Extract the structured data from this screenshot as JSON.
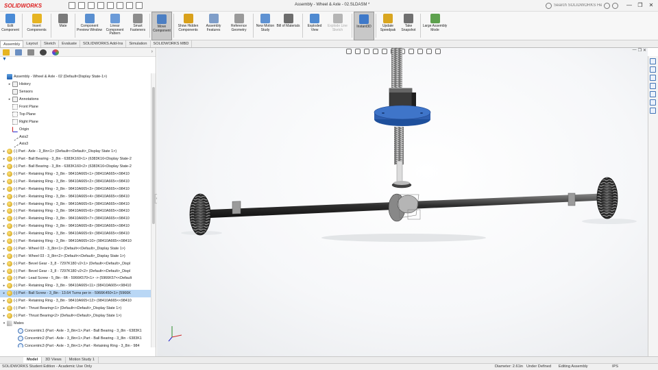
{
  "app": {
    "logo_text": "SOLIDWORKS",
    "title": "Assembly - Wheel & Axle - 02.SLDASM *",
    "search_placeholder": "Search SOLIDWORKS Help",
    "window_controls": [
      "—",
      "❐",
      "✕"
    ]
  },
  "quick_access": [
    "new-icon",
    "open-icon",
    "save-icon",
    "print-icon",
    "undo-icon",
    "select-icon",
    "rebuild-icon",
    "options-icon"
  ],
  "ribbon": {
    "buttons": [
      {
        "label": "Edit Component",
        "icon": "edit-component-icon",
        "color": "#4a8bd6"
      },
      {
        "label": "Insert Components",
        "icon": "insert-components-icon",
        "color": "#e6b422"
      },
      {
        "label": "Mate",
        "icon": "mate-icon",
        "color": "#7a7a7a"
      },
      {
        "label": "Component Preview Window",
        "icon": "preview-window-icon",
        "color": "#5a8fd0"
      },
      {
        "label": "Linear Component Pattern",
        "icon": "linear-pattern-icon",
        "color": "#6b9bd8"
      },
      {
        "label": "Smart Fasteners",
        "icon": "smart-fasteners-icon",
        "color": "#8c8c8c"
      },
      {
        "label": "Move Component",
        "icon": "move-component-icon",
        "color": "#4c7fc3",
        "active": true
      },
      {
        "label": "Show Hidden Components",
        "icon": "show-hidden-icon",
        "color": "#d9a11c"
      },
      {
        "label": "Assembly Features",
        "icon": "assembly-features-icon",
        "color": "#7f9ec9"
      },
      {
        "label": "Reference Geometry",
        "icon": "reference-geometry-icon",
        "color": "#9a9a9a"
      },
      {
        "label": "New Motion Study",
        "icon": "motion-study-icon",
        "color": "#5f92d2"
      },
      {
        "label": "Bill of Materials",
        "icon": "bom-icon",
        "color": "#6d6d6d"
      },
      {
        "label": "Exploded View",
        "icon": "exploded-view-icon",
        "color": "#4f8ad1"
      },
      {
        "label": "Explode Line Sketch",
        "icon": "explode-line-icon",
        "color": "#b5b5b5",
        "disabled": true
      },
      {
        "label": "Instant3D",
        "icon": "instant3d-icon",
        "color": "#3e79c9",
        "active": true
      },
      {
        "label": "Update Speedpak",
        "icon": "speedpak-icon",
        "color": "#d9a620"
      },
      {
        "label": "Take Snapshot",
        "icon": "snapshot-icon",
        "color": "#707070"
      },
      {
        "label": "Large Assembly Mode",
        "icon": "large-assembly-icon",
        "color": "#5ea14e"
      }
    ]
  },
  "command_tabs": [
    {
      "label": "Assembly",
      "active": true
    },
    {
      "label": "Layout"
    },
    {
      "label": "Sketch"
    },
    {
      "label": "Evaluate"
    },
    {
      "label": "SOLIDWORKS Add-Ins"
    },
    {
      "label": "Simulation"
    },
    {
      "label": "SOLIDWORKS MBD"
    }
  ],
  "tree": [
    {
      "label": "Assembly - Wheel & Axle - 02  (Default<Display State-1>)",
      "icon": "blue",
      "indent": 0,
      "exp": ""
    },
    {
      "label": "History",
      "icon": "folder",
      "indent": 1,
      "exp": "▸"
    },
    {
      "label": "Sensors",
      "icon": "folder",
      "indent": 1,
      "exp": ""
    },
    {
      "label": "Annotations",
      "icon": "folder",
      "indent": 1,
      "exp": "▸"
    },
    {
      "label": "Front Plane",
      "icon": "plane",
      "indent": 1,
      "exp": ""
    },
    {
      "label": "Top Plane",
      "icon": "plane",
      "indent": 1,
      "exp": ""
    },
    {
      "label": "Right Plane",
      "icon": "plane",
      "indent": 1,
      "exp": ""
    },
    {
      "label": "Origin",
      "icon": "origin",
      "indent": 1,
      "exp": ""
    },
    {
      "label": "Axis2",
      "icon": "axis",
      "indent": 1,
      "exp": ""
    },
    {
      "label": "Axis3",
      "icon": "axis",
      "indent": 1,
      "exp": ""
    },
    {
      "label": "(-) Part - Axle - 3_8in<1> (Default<<Default>_Display State 1>)",
      "icon": "gold",
      "indent": 0,
      "exp": "▸"
    },
    {
      "label": "(-) Part - Ball Bearing - 3_8in - 6383K160<1> (6383K16<Display State-2",
      "icon": "gold",
      "indent": 0,
      "exp": "▸"
    },
    {
      "label": "(-) Part - Ball Bearing - 3_8in - 6383K160<2> (6383K16<Display State-2",
      "icon": "gold",
      "indent": 0,
      "exp": "▸"
    },
    {
      "label": "(-) Part - Retaining Ring - 3_8in - 98410A665<1> (98410A665<<98410",
      "icon": "gold",
      "indent": 0,
      "exp": "▸"
    },
    {
      "label": "(-) Part - Retaining Ring - 3_8in - 98410A665<2> (98410A665<<98410",
      "icon": "gold",
      "indent": 0,
      "exp": "▸"
    },
    {
      "label": "(-) Part - Retaining Ring - 3_8in - 98410A665<3> (98410A665<<98410",
      "icon": "gold",
      "indent": 0,
      "exp": "▸"
    },
    {
      "label": "(-) Part - Retaining Ring - 3_8in - 98410A665<4> (98410A665<<98410",
      "icon": "gold",
      "indent": 0,
      "exp": "▸"
    },
    {
      "label": "(-) Part - Retaining Ring - 3_8in - 98410A665<5> (98410A665<<98410",
      "icon": "gold",
      "indent": 0,
      "exp": "▸"
    },
    {
      "label": "(-) Part - Retaining Ring - 3_8in - 98410A665<6> (98410A665<<98410",
      "icon": "gold",
      "indent": 0,
      "exp": "▸"
    },
    {
      "label": "(-) Part - Retaining Ring - 3_8in - 98410A665<7> (98410A665<<98410",
      "icon": "gold",
      "indent": 0,
      "exp": "▸"
    },
    {
      "label": "(-) Part - Retaining Ring - 3_8in - 98410A665<8> (98410A665<<98410",
      "icon": "gold",
      "indent": 0,
      "exp": "▸"
    },
    {
      "label": "(-) Part - Retaining Ring - 3_8in - 98410A665<9> (98410A665<<98410",
      "icon": "gold",
      "indent": 0,
      "exp": "▸"
    },
    {
      "label": "(-) Part - Retaining Ring - 3_8in - 98410A665<10> (98410A665<<98410",
      "icon": "gold",
      "indent": 0,
      "exp": "▸"
    },
    {
      "label": "(-) Part - Wheel 03 - 3_8in<1> (Default<<Default>_Display State 1>)",
      "icon": "gold",
      "indent": 0,
      "exp": "▸"
    },
    {
      "label": "(-) Part - Wheel 03 - 3_8in<2> (Default<<Default>_Display State 1>)",
      "icon": "gold",
      "indent": 0,
      "exp": "▸"
    },
    {
      "label": "(-) Part - Bevel Gear - 3_8 - 7297K180 v2<1> (Default<<Default>_Displ",
      "icon": "gold",
      "indent": 0,
      "exp": "▸"
    },
    {
      "label": "(-) Part - Bevel Gear - 3_8 - 7297K180 v2<2> (Default<<Default>_Displ",
      "icon": "gold",
      "indent": 0,
      "exp": "▸"
    },
    {
      "label": "(-) Part - Lead Screw - 5_8in - 6ft - 5966K570<1> -> (5966K57<<Default",
      "icon": "gold",
      "indent": 0,
      "exp": "▸"
    },
    {
      "label": "(-) Part - Retaining Ring - 3_8in - 98410A665<11> (98410A665<<98410",
      "icon": "gold",
      "indent": 0,
      "exp": "▸"
    },
    {
      "label": "(-) Part - Ball Screw - 3_8in - 13.64 Turns per in - 5966K450<1> (5966K",
      "icon": "gold",
      "indent": 0,
      "exp": "▸",
      "selected": true
    },
    {
      "label": "(-) Part - Retaining Ring - 3_8in - 98410A665<12> (98410A665<<98410",
      "icon": "gold",
      "indent": 0,
      "exp": "▸"
    },
    {
      "label": "(-) Part - Thrust Bearing<1> (Default<<Default>_Display State 1>)",
      "icon": "gold",
      "indent": 0,
      "exp": "▸"
    },
    {
      "label": "(-) Part - Thrust Bearing<2> (Default<<Default>_Display State 1>)",
      "icon": "gold",
      "indent": 0,
      "exp": "▸"
    },
    {
      "label": "Mates",
      "icon": "mates",
      "indent": 0,
      "exp": "▾"
    },
    {
      "label": "Concentric1 (Part - Axle - 3_8in<1>,Part - Ball Bearing - 3_8in - 6383K1",
      "icon": "mate",
      "indent": 2,
      "exp": ""
    },
    {
      "label": "Concentric2 (Part - Axle - 3_8in<1>,Part - Ball Bearing - 3_8in - 6383K1",
      "icon": "mate",
      "indent": 2,
      "exp": ""
    },
    {
      "label": "Concentric3 (Part - Axle - 3_8in<1>,Part - Retaining Ring - 3_8in - 984",
      "icon": "mate",
      "indent": 2,
      "exp": ""
    }
  ],
  "bottom_tabs": [
    {
      "label": "Model",
      "active": true
    },
    {
      "label": "3D Views"
    },
    {
      "label": "Motion Study 1"
    }
  ],
  "status": {
    "edition": "SOLIDWORKS Student Edition - Academic Use Only",
    "diameter": "Diameter: 2.61in",
    "defined": "Under Defined",
    "mode": "Editing Assembly",
    "units": "IPS"
  },
  "colors": {
    "flange_blue": "#2f5fb0",
    "selection": "#b9d7f5",
    "brand_red": "#d22222"
  }
}
